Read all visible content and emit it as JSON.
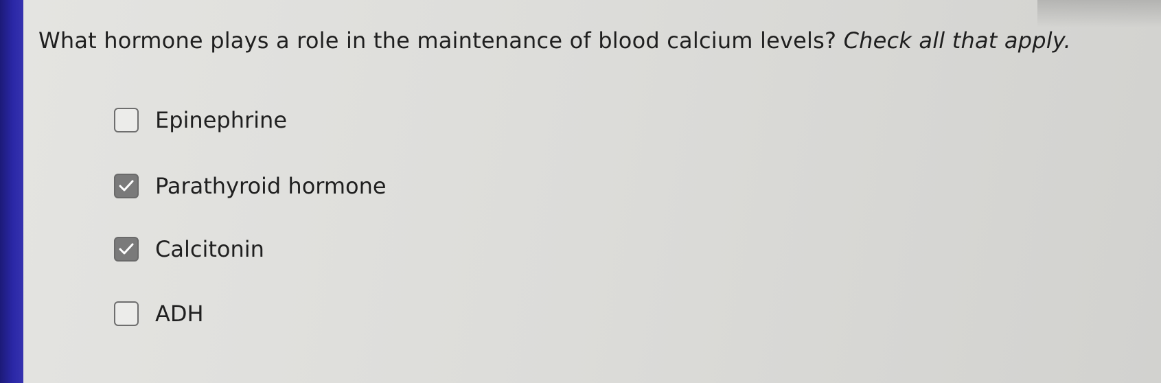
{
  "question": {
    "text": "What hormone plays a role in the maintenance of blood calcium levels?",
    "instruction": "Check all that apply."
  },
  "options": [
    {
      "label": "Epinephrine",
      "checked": false
    },
    {
      "label": "Parathyroid hormone",
      "checked": true
    },
    {
      "label": "Calcitonin",
      "checked": true
    },
    {
      "label": "ADH",
      "checked": false
    }
  ],
  "colors": {
    "left_bar": "#2a27a6",
    "background": "#dcdcd9",
    "checkbox_checked": "#7a7a7a",
    "text": "#1f1f1f"
  },
  "icons": {
    "check": "check-icon"
  }
}
